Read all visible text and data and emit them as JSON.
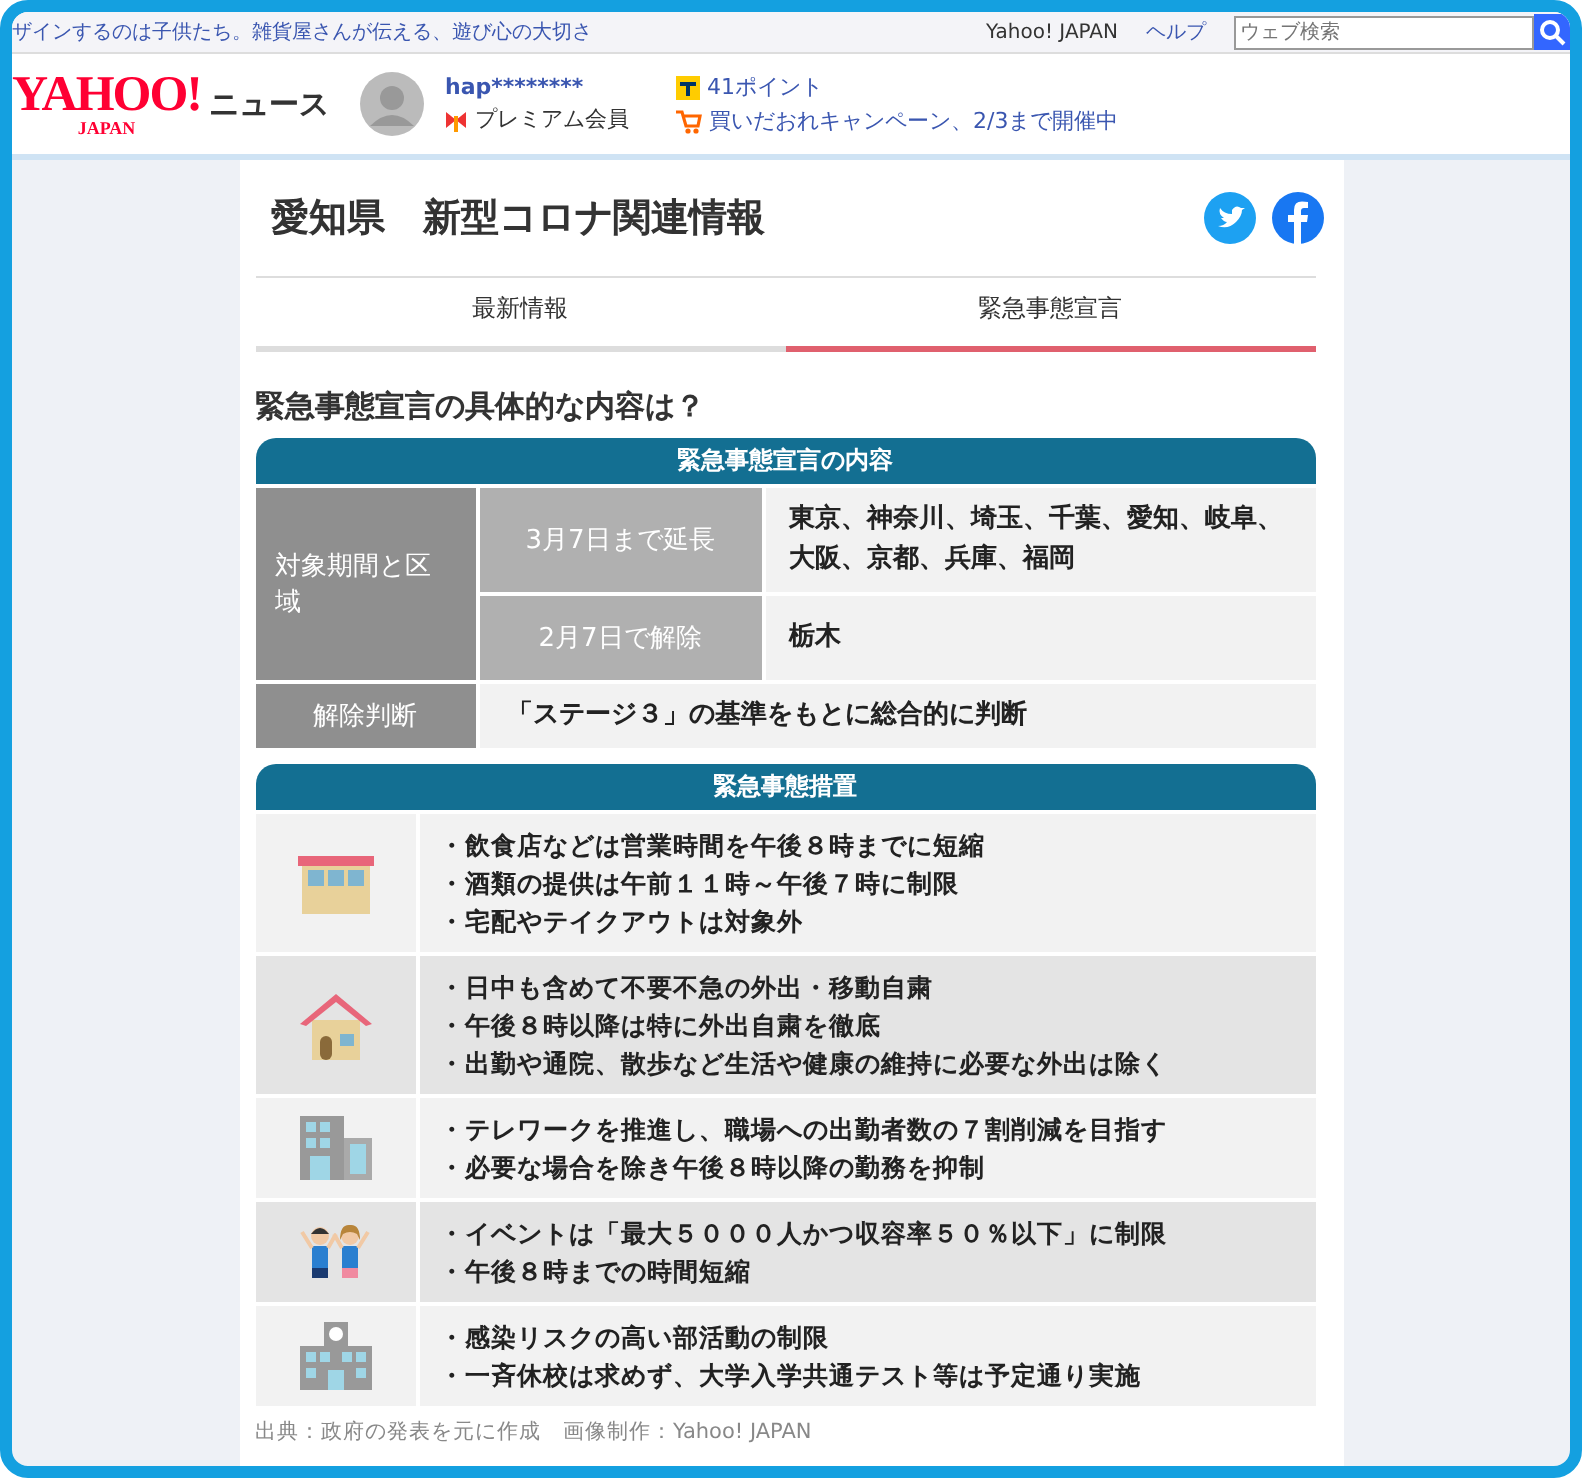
{
  "top_bar": {
    "ticker": "ザインするのは子供たち。雑貨屋さんが伝える、遊び心の大切さ",
    "links": [
      "Yahoo! JAPAN",
      "ヘルプ"
    ],
    "search": {
      "placeholder": "ウェブ検索"
    }
  },
  "header": {
    "logo_main": "YAHOO!",
    "logo_sub": "JAPAN",
    "service": "ニュース",
    "user": "hap********",
    "membership": "プレミアム会員",
    "points": "41ポイント",
    "campaign": "買いだおれキャンペーン、2/3まで開催中"
  },
  "article": {
    "title": "愛知県　新型コロナ関連情報",
    "tabs": [
      {
        "label": "最新情報",
        "selected": false
      },
      {
        "label": "緊急事態宣言",
        "selected": true
      }
    ],
    "heading": "緊急事態宣言の具体的な内容は？",
    "declaration": {
      "title": "緊急事態宣言の内容",
      "period_label": "対象期間と区域",
      "periods": [
        {
          "label": "3月7日まで延長",
          "regions": "東京、神奈川、埼玉、千葉、愛知、岐阜、大阪、京都、兵庫、福岡"
        },
        {
          "label": "2月7日で解除",
          "regions": "栃木"
        }
      ],
      "judgement_label": "解除判断",
      "judgement": "「ステージ３」の基準をもとに総合的に判断"
    },
    "measures": {
      "title": "緊急事態措置",
      "rows": [
        {
          "kind": "shop",
          "items": [
            "・飲食店などは営業時間を午後８時までに短縮",
            "・酒類の提供は午前１１時～午後７時に制限",
            "・宅配やテイクアウトは対象外"
          ]
        },
        {
          "kind": "house",
          "items": [
            "・日中も含めて不要不急の外出・移動自粛",
            "・午後８時以降は特に外出自粛を徹底",
            "・出勤や通院、散歩など生活や健康の維持に必要な外出は除く"
          ]
        },
        {
          "kind": "office",
          "items": [
            "・テレワークを推進し、職場への出勤者数の７割削減を目指す",
            "・必要な場合を除き午後８時以降の勤務を抑制"
          ]
        },
        {
          "kind": "people",
          "items": [
            "・イベントは「最大５０００人かつ収容率５０％以下」に制限",
            "・午後８時までの時間短縮"
          ]
        },
        {
          "kind": "school",
          "items": [
            "・感染リスクの高い部活動の制限",
            "・一斉休校は求めず、大学入学共通テスト等は予定通り実施"
          ]
        }
      ]
    },
    "caption": "出典：政府の発表を元に作成　画像制作：Yahoo! JAPAN"
  }
}
